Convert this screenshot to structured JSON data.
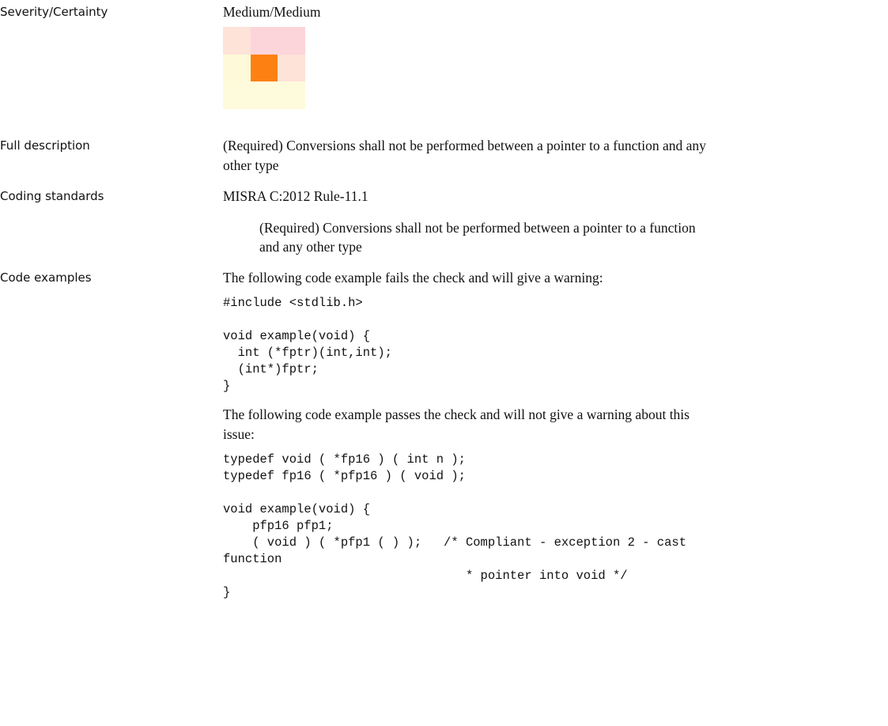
{
  "severity": {
    "label": "Severity/Certainty",
    "value": "Medium/Medium",
    "matrix_colors": [
      [
        "#fde3d8",
        "#fcd5da",
        "#fcd5da"
      ],
      [
        "#fef9d8",
        "#fd8112",
        "#fde3d8"
      ],
      [
        "#fefbdc",
        "#fefbdc",
        "#fefbdc"
      ]
    ]
  },
  "full_description": {
    "label": "Full description",
    "text_line1": "(Required) Conversions shall not be performed between a pointer to a function and any",
    "text_line2": "other type"
  },
  "coding_standards": {
    "label": "Coding standards",
    "standard": "MISRA C:2012 Rule-11.1",
    "detail_line1": "(Required) Conversions shall not be performed between a pointer to a function",
    "detail_line2": "and any other type"
  },
  "code_examples": {
    "label": "Code examples",
    "fail_intro": "The following code example fails the check and will give a warning:",
    "fail_code": "#include <stdlib.h>\n\nvoid example(void) {\n  int (*fptr)(int,int);\n  (int*)fptr;\n}",
    "pass_intro_line1": "The following code example passes the check and will not give a warning about this",
    "pass_intro_line2": "issue:",
    "pass_code": "typedef void ( *fp16 ) ( int n );\ntypedef fp16 ( *pfp16 ) ( void );\n\nvoid example(void) {\n    pfp16 pfp1;\n    ( void ) ( *pfp1 ( ) );   /* Compliant - exception 2 - cast\nfunction\n                                 * pointer into void */\n}"
  }
}
